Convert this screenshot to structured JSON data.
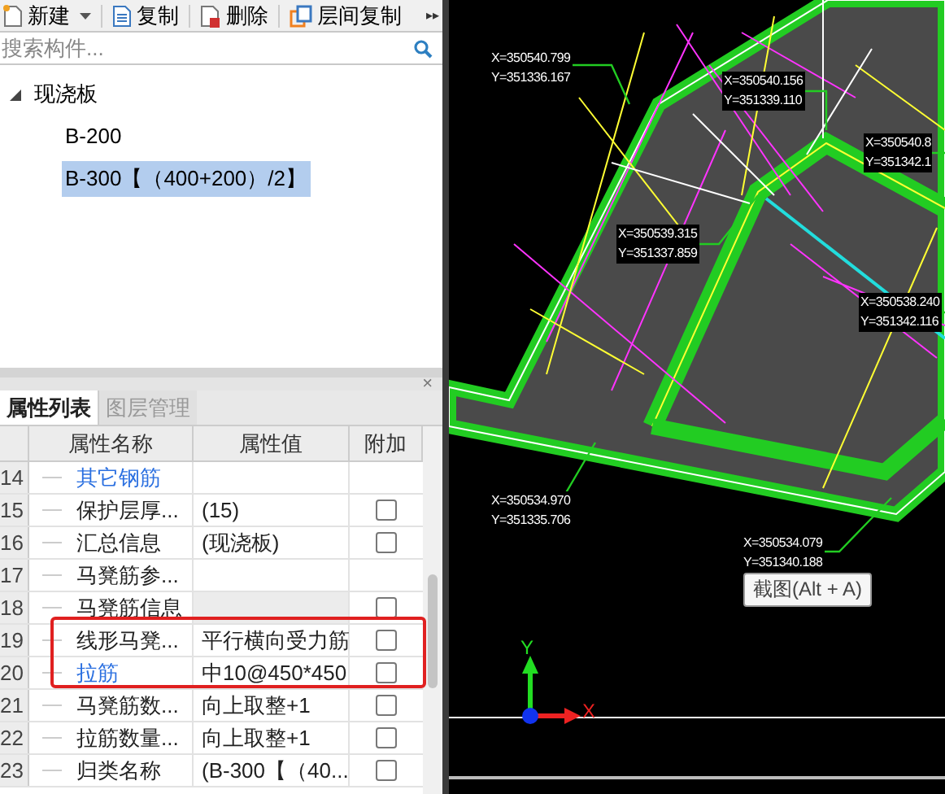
{
  "toolbar": {
    "buttons": [
      {
        "label": "新建",
        "kind": "new"
      },
      {
        "label": "复制",
        "kind": "copy"
      },
      {
        "label": "删除",
        "kind": "delete"
      },
      {
        "label": "层间复制",
        "kind": "floor-copy"
      }
    ],
    "more": "▸▸"
  },
  "search": {
    "placeholder": "搜索构件..."
  },
  "tree": [
    {
      "label": "现浇板",
      "expanded": true,
      "selected": false,
      "children": [
        {
          "label": "B-200",
          "selected": false
        },
        {
          "label": "B-300【（400+200）/2】",
          "selected": true
        }
      ]
    }
  ],
  "panel": {
    "close": "×",
    "tabs": [
      {
        "label": "属性列表",
        "selected": true
      },
      {
        "label": "图层管理",
        "selected": false
      }
    ]
  },
  "table": {
    "columns": [
      "属性名称",
      "属性值",
      "附加"
    ],
    "rows": [
      {
        "index": "14",
        "name": "其它钢筋",
        "value": "",
        "kind": "link",
        "checkbox": false
      },
      {
        "index": "15",
        "name": "保护层厚...",
        "value": "(15)",
        "kind": "plain",
        "checkbox": true,
        "checked": false
      },
      {
        "index": "16",
        "name": "汇总信息",
        "value": "(现浇板)",
        "kind": "plain",
        "checkbox": true,
        "checked": false
      },
      {
        "index": "17",
        "name": "马凳筋参...",
        "value": "",
        "kind": "plain",
        "checkbox": false
      },
      {
        "index": "18",
        "name": "马凳筋信息",
        "value": "",
        "kind": "disabled",
        "checkbox": true,
        "checked": false
      },
      {
        "index": "19",
        "name": "线形马凳...",
        "value": "平行横向受力筋",
        "kind": "plain",
        "checkbox": true,
        "checked": false
      },
      {
        "index": "20",
        "name": "拉筋",
        "value": "中10@450*450",
        "kind": "link",
        "checkbox": true,
        "checked": false
      },
      {
        "index": "21",
        "name": "马凳筋数...",
        "value": "向上取整+1",
        "kind": "plain",
        "checkbox": true,
        "checked": false
      },
      {
        "index": "22",
        "name": "拉筋数量...",
        "value": "向上取整+1",
        "kind": "plain",
        "checkbox": true,
        "checked": false
      },
      {
        "index": "23",
        "name": "归类名称",
        "value": "(B-300【（40...",
        "kind": "plain",
        "checkbox": true,
        "checked": false
      }
    ]
  },
  "canvas": {
    "coordinates": [
      {
        "x": "X=350540.799",
        "y": "Y=351336.167"
      },
      {
        "x": "X=350540.156",
        "y": "Y=351339.110"
      },
      {
        "x": "X=350540.8",
        "y": "Y=351342.1"
      },
      {
        "x": "X=350539.315",
        "y": "Y=351337.859"
      },
      {
        "x": "X=350538.240",
        "y": "Y=351342.116"
      },
      {
        "x": "X=350534.970",
        "y": "Y=351335.706"
      },
      {
        "x": "X=350534.079",
        "y": "Y=351340.188"
      }
    ],
    "tooltip": "截图(Alt + A)",
    "axis_x": "X",
    "axis_y": "Y"
  }
}
